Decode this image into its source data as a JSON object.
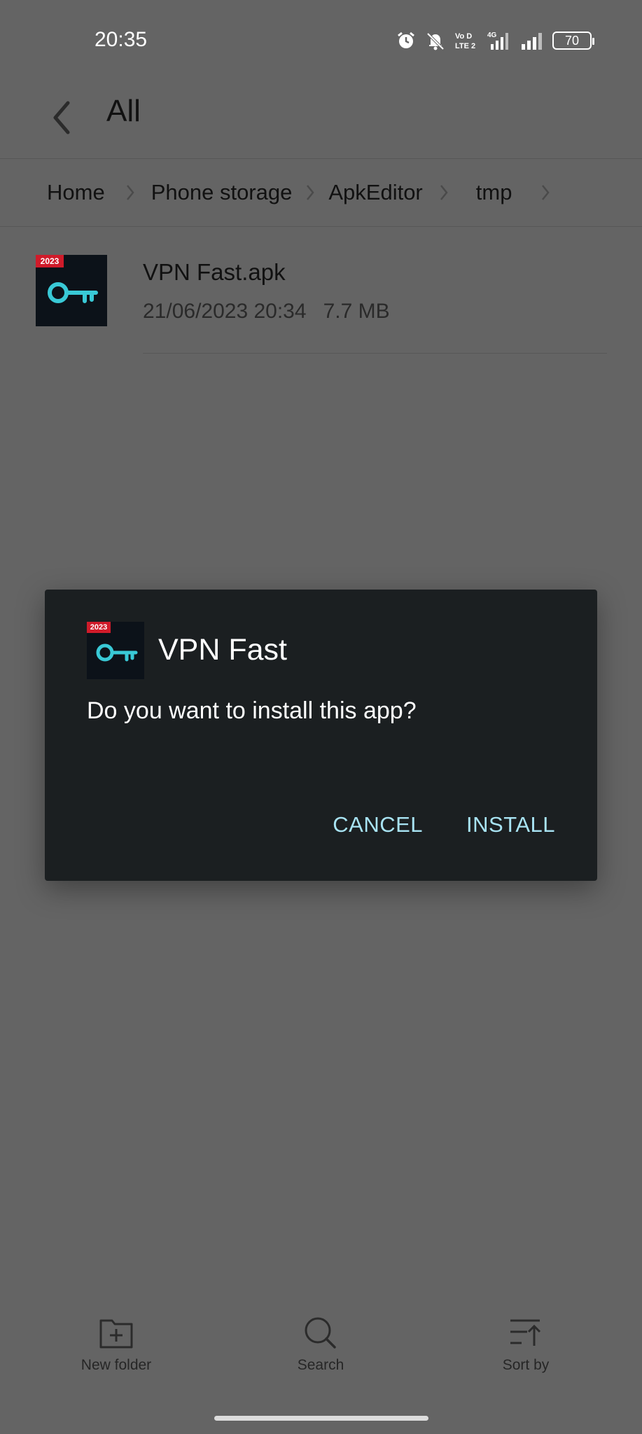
{
  "status_bar": {
    "time": "20:35",
    "battery_level": "70",
    "network_label": "4G",
    "volte_label": "Vo LTE"
  },
  "header": {
    "title": "All"
  },
  "breadcrumb": {
    "items": [
      "Home",
      "Phone storage",
      "ApkEditor",
      "tmp"
    ]
  },
  "file": {
    "name": "VPN Fast.apk",
    "date": "21/06/2023 20:34",
    "size": "7.7 MB",
    "icon_badge": "2023"
  },
  "dialog": {
    "app_name": "VPN Fast",
    "icon_badge": "2023",
    "message": "Do you want to install this app?",
    "cancel_label": "CANCEL",
    "install_label": "INSTALL"
  },
  "bottom_bar": {
    "new_folder_label": "New folder",
    "search_label": "Search",
    "sort_label": "Sort by"
  },
  "colors": {
    "background": "#646464",
    "dialog_bg": "#1b1f21",
    "accent": "#a8e3f3",
    "badge": "#d01b2a"
  }
}
